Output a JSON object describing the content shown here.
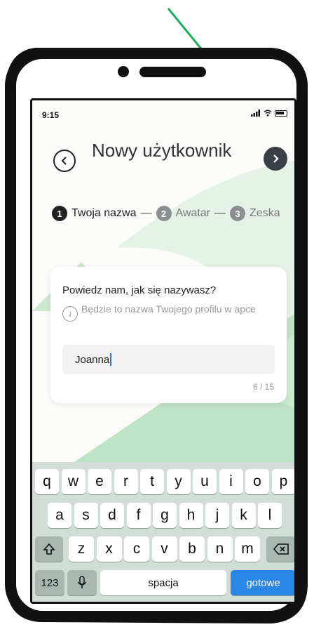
{
  "status_bar": {
    "time": "9:15"
  },
  "header": {
    "title": "Nowy użytkownik",
    "back_icon": "chevron-left-icon",
    "next_icon": "chevron-right-icon"
  },
  "steps": [
    {
      "number": "1",
      "label": "Twoja nazwa",
      "state": "active"
    },
    {
      "number": "2",
      "label": "Awatar",
      "state": "inactive"
    },
    {
      "number": "3",
      "label": "Zeska",
      "state": "inactive"
    }
  ],
  "step_separator": "—",
  "card": {
    "question": "Powiedz nam, jak się nazywasz?",
    "hint": "Będzie to nazwa Twojego profilu w apce",
    "info_icon": "info-icon",
    "name_value": "Joanna",
    "counter": "6 / 15"
  },
  "keyboard": {
    "row1": [
      "q",
      "w",
      "e",
      "r",
      "t",
      "y",
      "u",
      "i",
      "o",
      "p"
    ],
    "row2": [
      "a",
      "s",
      "d",
      "f",
      "g",
      "h",
      "j",
      "k",
      "l"
    ],
    "row3": [
      "z",
      "x",
      "c",
      "v",
      "b",
      "n",
      "m"
    ],
    "numbers_key": "123",
    "space_key": "spacja",
    "done_key": "gotowe",
    "shift_icon": "shift-icon",
    "backspace_icon": "backspace-icon",
    "mic_icon": "microphone-icon"
  },
  "colors": {
    "accent_green": "#bfe3c6",
    "done_blue": "#2a86e6",
    "annotation_arrow": "#1faa59"
  }
}
